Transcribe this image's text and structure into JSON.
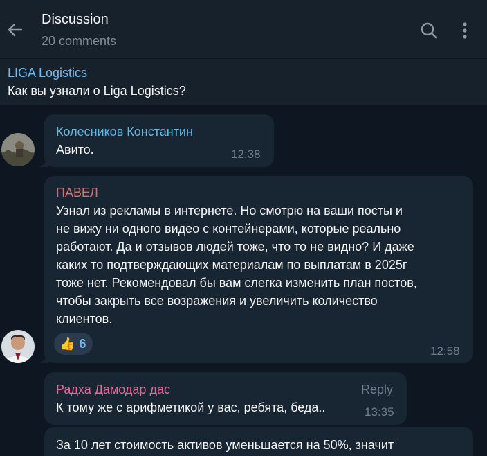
{
  "header": {
    "title": "Discussion",
    "subtitle": "20 comments"
  },
  "post_ref": {
    "author": "LIGA Logistics",
    "text": "Как вы узнали о Liga Logistics?"
  },
  "messages": [
    {
      "author": "Колесников Константин",
      "author_color": "#64b9e0",
      "text": "Авито.",
      "time": "12:38"
    },
    {
      "author": "ПАВЕЛ",
      "author_color": "#e56b6b",
      "lines": [
        "Узнал из рекламы в интернете. Но смотрю на ваши посты и",
        "не вижу ни одного видео с контейнерами, которые реально",
        "работают. Да и отзывов людей тоже, что то не видно? И даже",
        "каких то подтверждающих материалам по выплатам в 2025г",
        "тоже нет. Рекомендовал бы вам слегка изменить план постов,",
        "чтобы закрыть все возражения и увеличить количество",
        "клиентов."
      ],
      "reaction": {
        "emoji": "👍",
        "count": "6"
      },
      "time": "12:58"
    },
    {
      "author": "Радха Дамодар дас",
      "author_color": "#e8689a",
      "text": "К тому же с арифметикой у вас, ребята, беда..",
      "reply_label": "Reply",
      "time": "13:35"
    },
    {
      "text": "За 10 лет стоимость активов уменьшается на 50%, значит"
    }
  ]
}
